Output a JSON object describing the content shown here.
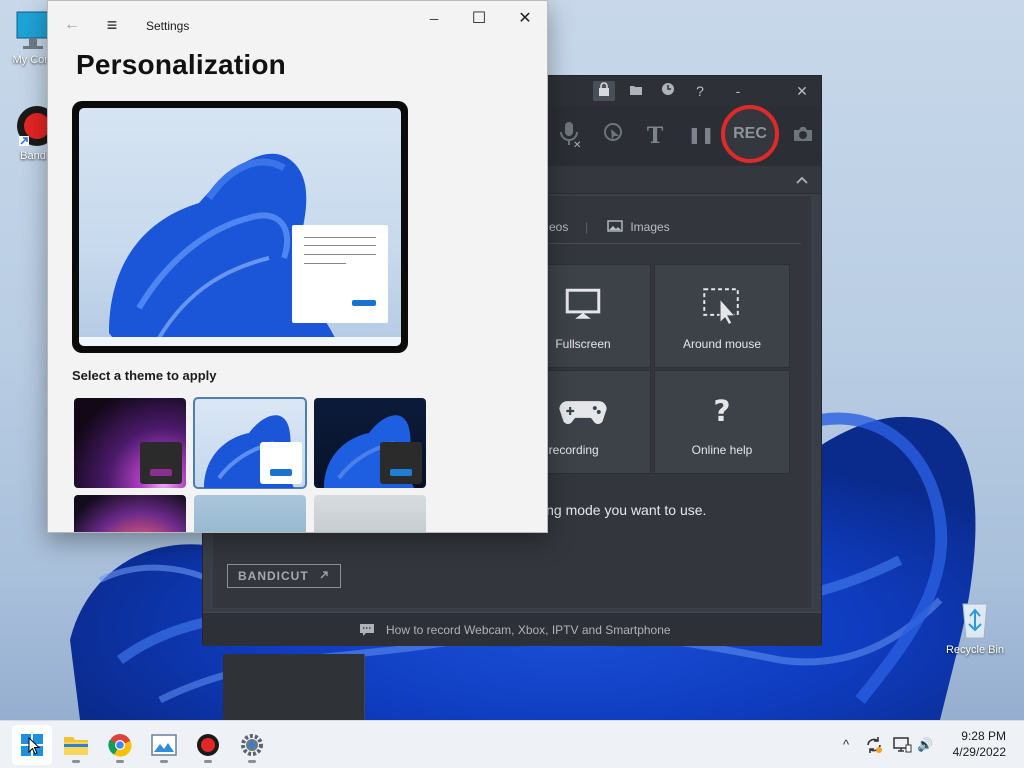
{
  "desktop": {
    "icons": [
      {
        "label": "My Com",
        "icon": "computer-icon"
      },
      {
        "label": "Bandic",
        "icon": "bandicam-shortcut-icon"
      },
      {
        "label": "Recycle Bin",
        "icon": "recycle-bin-icon"
      }
    ]
  },
  "settings": {
    "app_title": "Settings",
    "page_title": "Personalization",
    "theme_heading": "Select a theme to apply",
    "controls": {
      "back": "←",
      "menu": "≡",
      "minimize": "─",
      "maximize": "☐",
      "close": "✕"
    },
    "themes": [
      {
        "name": "theme-glow",
        "selected": false,
        "mini_bg": "#2b2b2b",
        "mini_bar": "#8a2f8f"
      },
      {
        "name": "theme-windows-light",
        "selected": true,
        "mini_bg": "#ffffff",
        "mini_bar": "#1a73d0"
      },
      {
        "name": "theme-windows-dark",
        "selected": false,
        "mini_bg": "#2b2b2b",
        "mini_bar": "#1f7fd6"
      },
      {
        "name": "theme-flower",
        "selected": false
      },
      {
        "name": "theme-landscape",
        "selected": false
      },
      {
        "name": "theme-captured-motion",
        "selected": false
      }
    ]
  },
  "bandicam": {
    "titlebar_icons": [
      "lock-icon",
      "folder-icon",
      "clock-icon",
      "help-icon",
      "minimize-icon",
      "close-icon"
    ],
    "titlebar_help": "?",
    "titlebar_min": "-",
    "titlebar_close": "✕",
    "toolbar_text_tool": "T",
    "toolbar_pause": "❚❚",
    "rec_label": "REC",
    "tabs": {
      "videos": "eos",
      "images": "Images"
    },
    "modes": [
      {
        "label": "Fullscreen",
        "icon": "monitor-icon"
      },
      {
        "label": "Around mouse",
        "icon": "mouse-region-icon"
      },
      {
        "label": "ame recording",
        "icon": "gamepad-icon"
      },
      {
        "label": "Online help",
        "icon": "question-icon"
      }
    ],
    "mode_hint": "ing mode you want to use.",
    "bandicut_label": "BANDICUT",
    "footer_text": "How to record Webcam, Xbox, IPTV and Smartphone"
  },
  "taskbar": {
    "apps": [
      {
        "name": "start-button",
        "icon": "windows-icon",
        "active": true
      },
      {
        "name": "file-explorer",
        "icon": "folder-icon"
      },
      {
        "name": "chrome",
        "icon": "chrome-icon"
      },
      {
        "name": "photos",
        "icon": "photos-icon"
      },
      {
        "name": "bandicam",
        "icon": "record-icon"
      },
      {
        "name": "settings",
        "icon": "gear-icon"
      }
    ],
    "tray": {
      "chevron": "^",
      "volume": "🔊"
    },
    "clock_time": "9:28 PM",
    "clock_date": "4/29/2022"
  },
  "colors": {
    "rec_ring": "#e02a2a",
    "accent_blue": "#1a73d0",
    "bandicam_bg": "#3a3f47"
  }
}
